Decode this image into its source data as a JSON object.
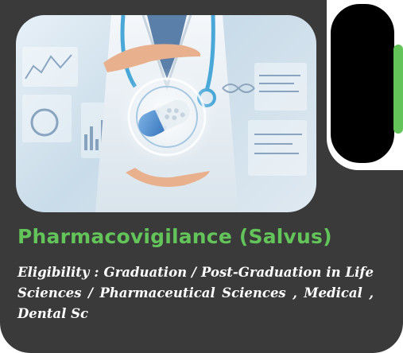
{
  "card": {
    "image_alt": "doctor holding capsule with medical data panels",
    "title": "Pharmacovigilance (Salvus)",
    "eligibility": "Eligibility : Graduation / Post-Graduation in Life Sciences / Pharmaceutical Sciences , Medical , Dental Sc"
  },
  "colors": {
    "card_background": "#3a3a3a",
    "accent_green": "#63c45a",
    "text_white": "#ffffff",
    "pill_black": "#000000"
  }
}
